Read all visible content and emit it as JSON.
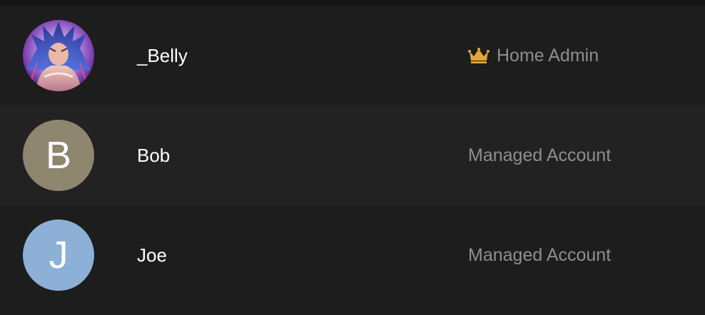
{
  "users": [
    {
      "name": "_Belly",
      "role": "Home Admin",
      "avatar_type": "image",
      "role_icon": "crown-icon",
      "role_icon_color": "#e0a53b"
    },
    {
      "name": "Bob",
      "role": "Managed Account",
      "avatar_type": "letter",
      "avatar_letter": "B",
      "avatar_color": "#8f8670"
    },
    {
      "name": "Joe",
      "role": "Managed Account",
      "avatar_type": "letter",
      "avatar_letter": "J",
      "avatar_color": "#8db0d6"
    }
  ],
  "colors": {
    "background": "#1b1b1b",
    "row_alt": "#222222",
    "name_text": "#ffffff",
    "role_text": "#8e8e8e"
  }
}
